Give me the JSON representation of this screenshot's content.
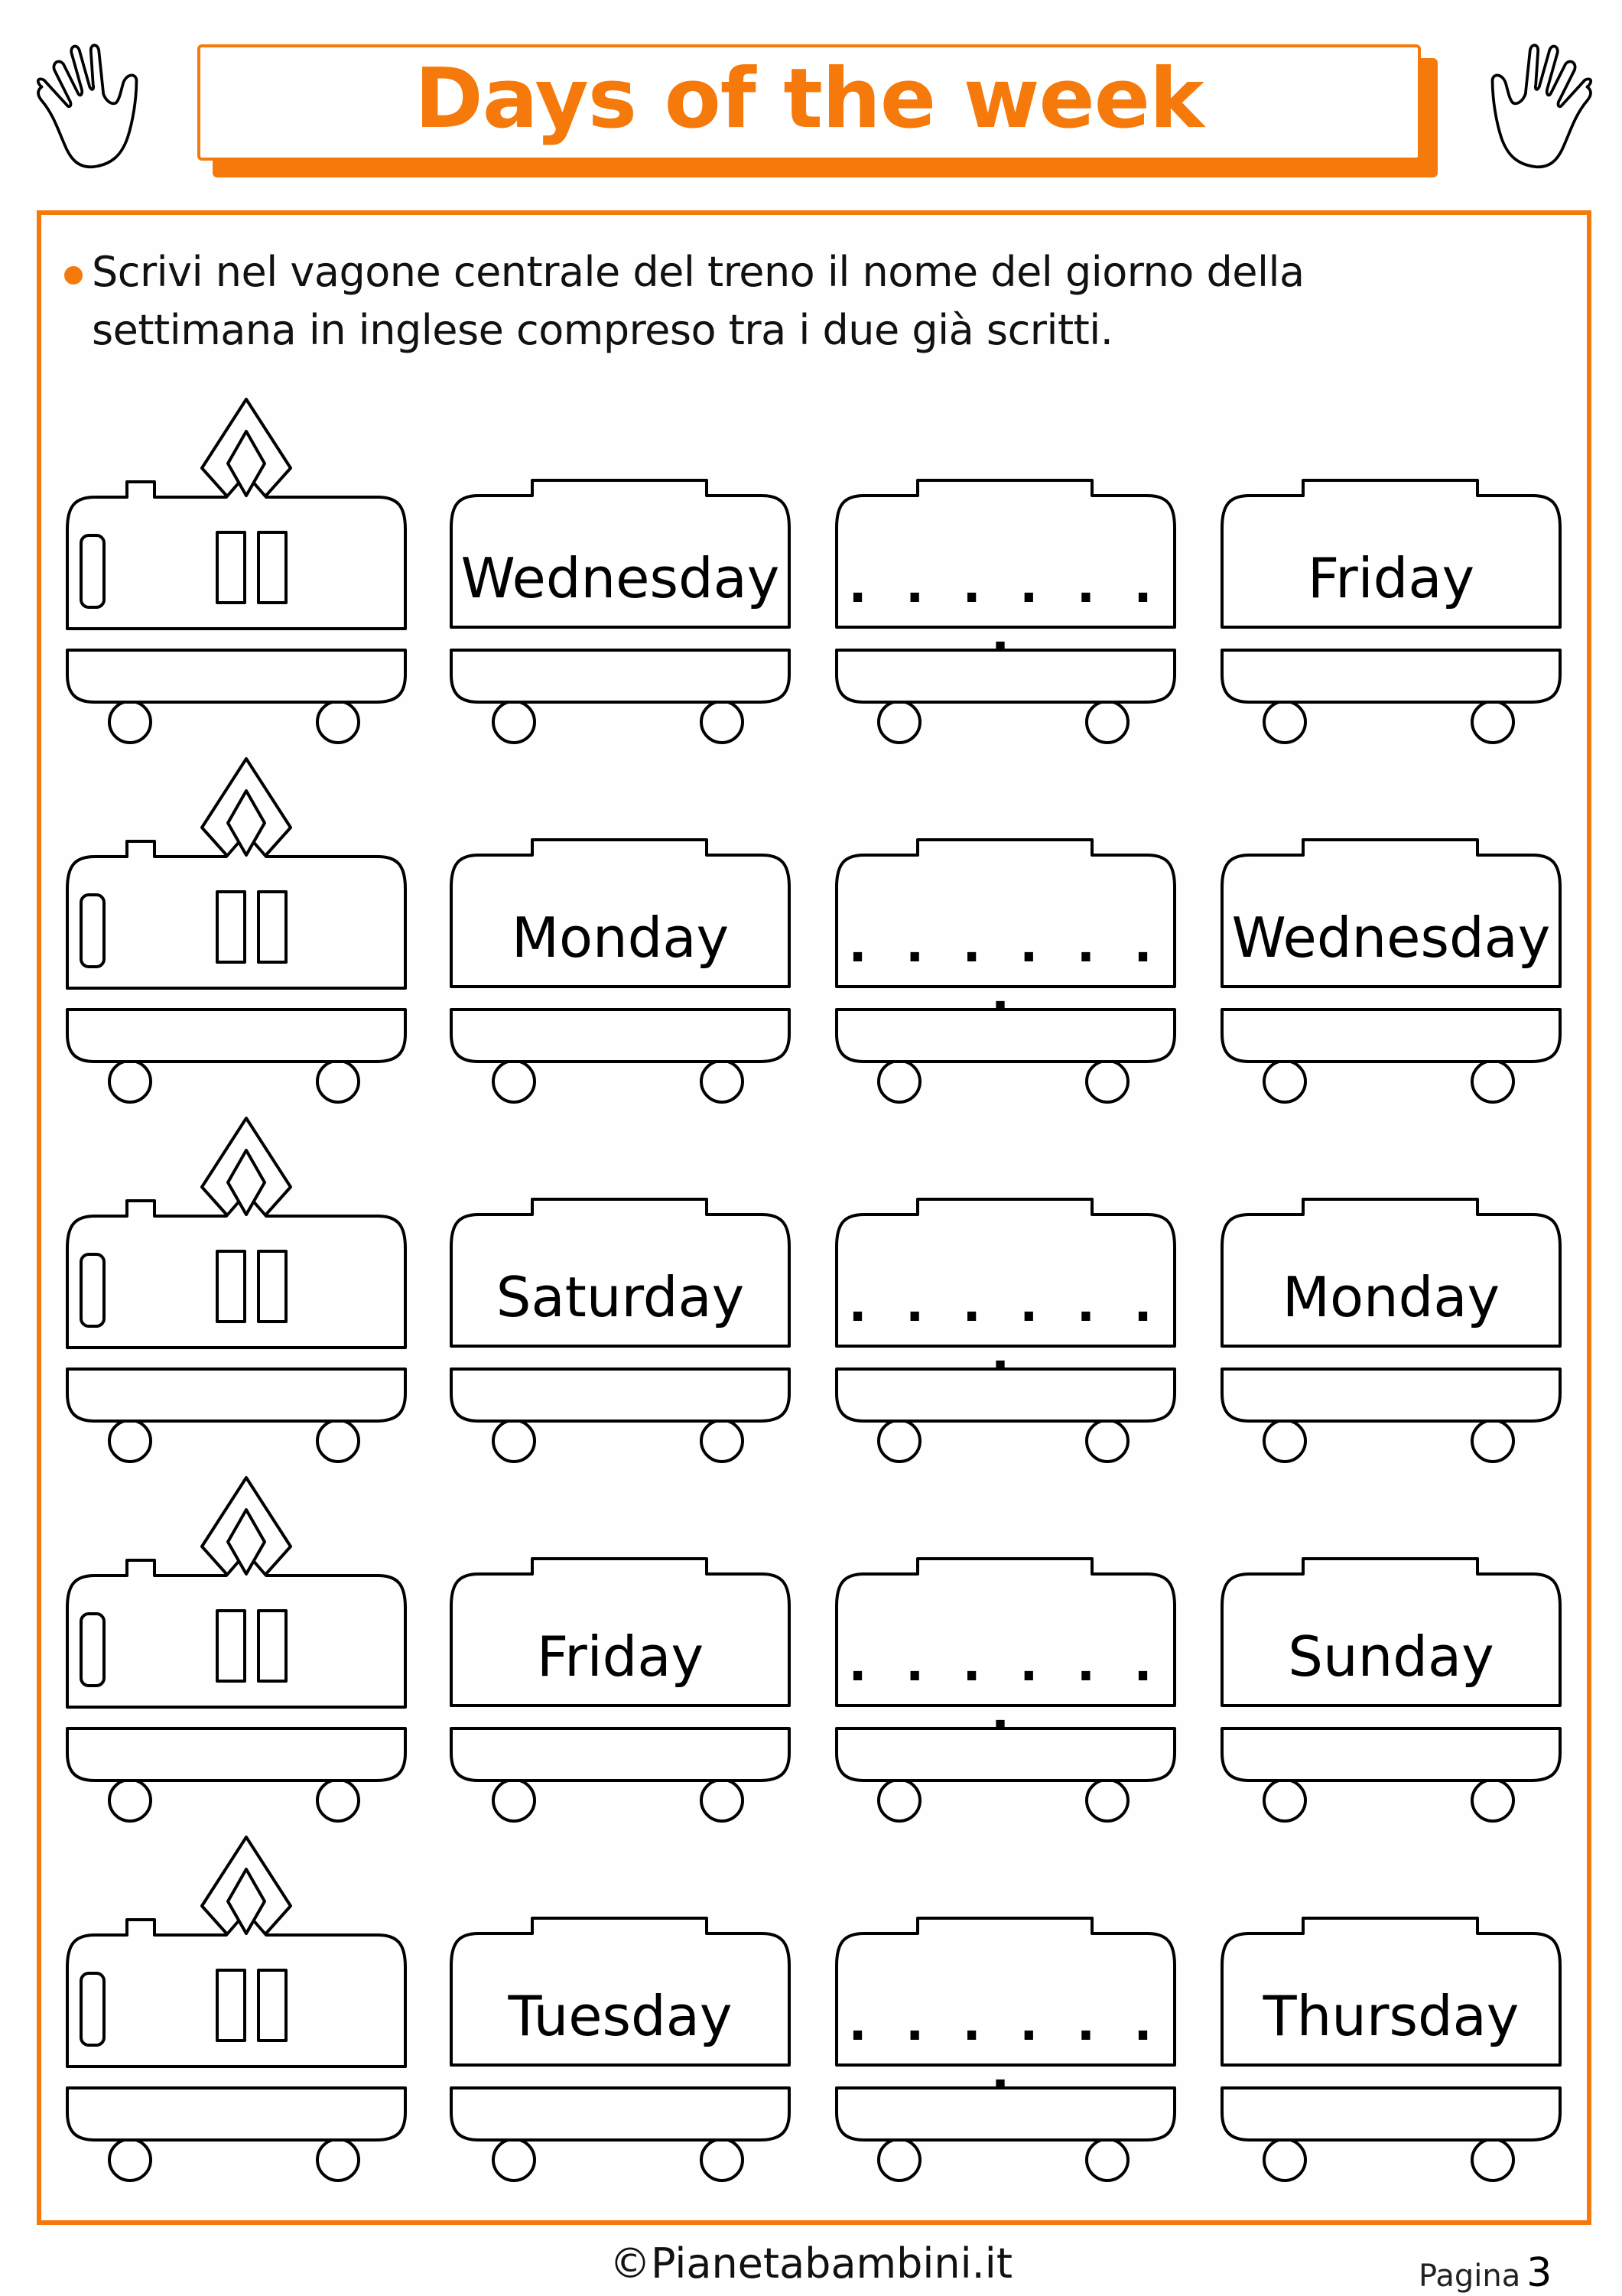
{
  "header": {
    "title": "Days of the week",
    "accent_color": "#f57a0b",
    "decor_icons": [
      "left-hand-icon",
      "right-hand-icon"
    ]
  },
  "instructions": {
    "line1": "Scrivi nel vagone centrale del treno il nome del giorno della",
    "line2": "settimana in inglese compreso tra i due già scritti."
  },
  "exercise": {
    "blank_placeholder": ". . . . . . .",
    "rows": [
      {
        "before": "Wednesday",
        "answer_blank": ". . . . . . .",
        "after": "Friday"
      },
      {
        "before": "Monday",
        "answer_blank": ". . . . . . .",
        "after": "Wednesday"
      },
      {
        "before": "Saturday",
        "answer_blank": ". . . . . . .",
        "after": "Monday"
      },
      {
        "before": "Friday",
        "answer_blank": ". . . . . . .",
        "after": "Sunday"
      },
      {
        "before": "Tuesday",
        "answer_blank": ". . . . . . .",
        "after": "Thursday"
      }
    ]
  },
  "footer": {
    "brand": "©Pianetabambini.it",
    "page_label": "Pagina",
    "page_number": "3"
  }
}
